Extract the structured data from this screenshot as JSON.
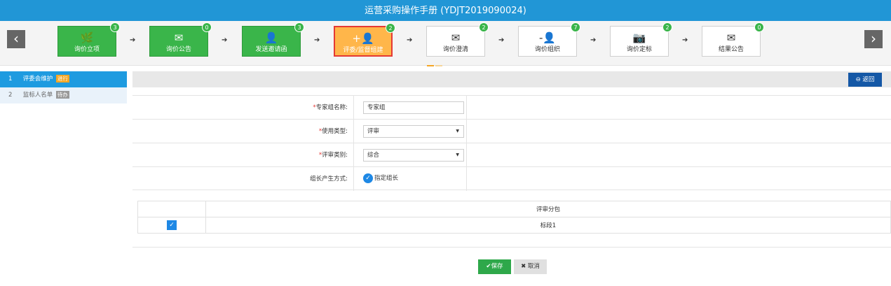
{
  "title": "运营采购操作手册 (YDJT2019090024)",
  "colors": {
    "title_bg": "#2196d6",
    "step_done": "#3ab54a",
    "step_active": "#ffb64a",
    "accent": "#1e9be0"
  },
  "steps": [
    {
      "label": "询价立项",
      "badge": "3",
      "icon": "leaf-icon",
      "glyph": "🌿"
    },
    {
      "label": "询价公告",
      "badge": "0",
      "icon": "envelope-icon",
      "glyph": "✉"
    },
    {
      "label": "发送邀请函",
      "badge": "3",
      "icon": "user-icon",
      "glyph": "👤"
    },
    {
      "label": "评委/监督组建",
      "badge": "2",
      "icon": "add-user-icon",
      "glyph": "+👤"
    },
    {
      "label": "询价澄清",
      "badge": "2",
      "icon": "envelope-icon",
      "glyph": "✉"
    },
    {
      "label": "询价组织",
      "badge": "7",
      "icon": "remove-user-icon",
      "glyph": "-👤"
    },
    {
      "label": "询价定标",
      "badge": "2",
      "icon": "camera-icon",
      "glyph": "📷"
    },
    {
      "label": "结果公告",
      "badge": "0",
      "icon": "envelope-icon",
      "glyph": "✉"
    }
  ],
  "sidebar": {
    "items": [
      {
        "num": "1",
        "label": "评委会维护",
        "tag": "进行"
      },
      {
        "num": "2",
        "label": "监标人名单",
        "tag": "待办"
      }
    ]
  },
  "toolbar": {
    "back_label": "⊖ 返回"
  },
  "form": {
    "group_name": {
      "label": "专家组名称:",
      "value": "专家组"
    },
    "usage_type": {
      "label": "使用类型:",
      "value": "评审"
    },
    "review_category": {
      "label": "评审类别:",
      "value": "综合"
    },
    "leader_method": {
      "label": "组长产生方式:",
      "option": "指定组长"
    }
  },
  "package_table": {
    "header": "评审分包",
    "rows": [
      {
        "name": "标段1",
        "checked": true
      }
    ]
  },
  "actions": {
    "save_label": "保存",
    "cancel_label": "取消"
  }
}
